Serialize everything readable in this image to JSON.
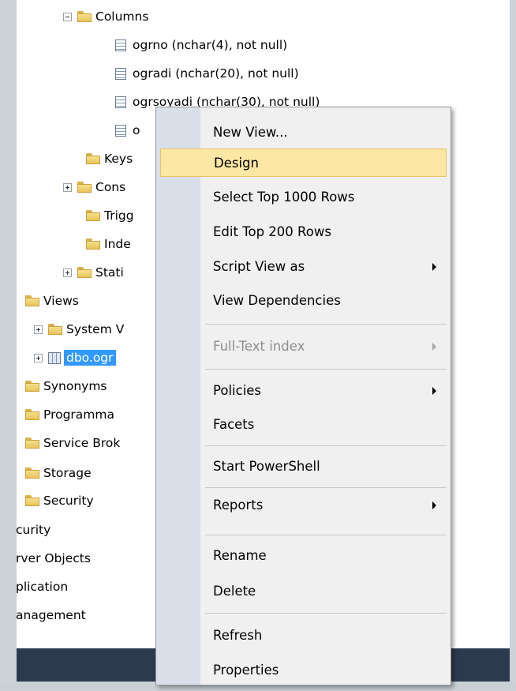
{
  "tree": {
    "columns_label": "Columns",
    "columns": [
      "ogrno (nchar(4), not null)",
      "ogradi (nchar(20), not null)",
      "ogrsoyadi (nchar(30), not null)",
      "o"
    ],
    "keys_label": "Keys",
    "constraints_label": "Cons",
    "triggers_label": "Trigg",
    "indexes_label": "Inde",
    "statistics_label": "Stati",
    "views_label": "Views",
    "system_views_label": "System V",
    "selected_view_label": "dbo.ogr",
    "synonyms_label": "Synonyms",
    "programmability_label": "Programma",
    "service_broker_label": "Service Brok",
    "storage_label": "Storage",
    "db_security_label": "Security",
    "security_label": "curity",
    "server_objects_label": "rver Objects",
    "replication_label": "plication",
    "management_label": "anagement"
  },
  "context_menu": {
    "items": [
      {
        "label": "New View...",
        "enabled": true,
        "submenu": false
      },
      {
        "label": "Design",
        "enabled": true,
        "submenu": false,
        "highlighted": true
      },
      {
        "label": "Select Top 1000 Rows",
        "enabled": true,
        "submenu": false
      },
      {
        "label": "Edit Top 200 Rows",
        "enabled": true,
        "submenu": false
      },
      {
        "label": "Script View as",
        "enabled": true,
        "submenu": true
      },
      {
        "label": "View Dependencies",
        "enabled": true,
        "submenu": false
      },
      {
        "label": "Full-Text index",
        "enabled": false,
        "submenu": true
      },
      {
        "label": "Policies",
        "enabled": true,
        "submenu": true
      },
      {
        "label": "Facets",
        "enabled": true,
        "submenu": false
      },
      {
        "label": "Start PowerShell",
        "enabled": true,
        "submenu": false
      },
      {
        "label": "Reports",
        "enabled": true,
        "submenu": true
      },
      {
        "label": "Rename",
        "enabled": true,
        "submenu": false
      },
      {
        "label": "Delete",
        "enabled": true,
        "submenu": false
      },
      {
        "label": "Refresh",
        "enabled": true,
        "submenu": false
      },
      {
        "label": "Properties",
        "enabled": true,
        "submenu": false
      }
    ]
  },
  "colors": {
    "highlight": "#fce7a4",
    "selection": "#3399ff",
    "bottom_band": "#2c3a4e"
  }
}
